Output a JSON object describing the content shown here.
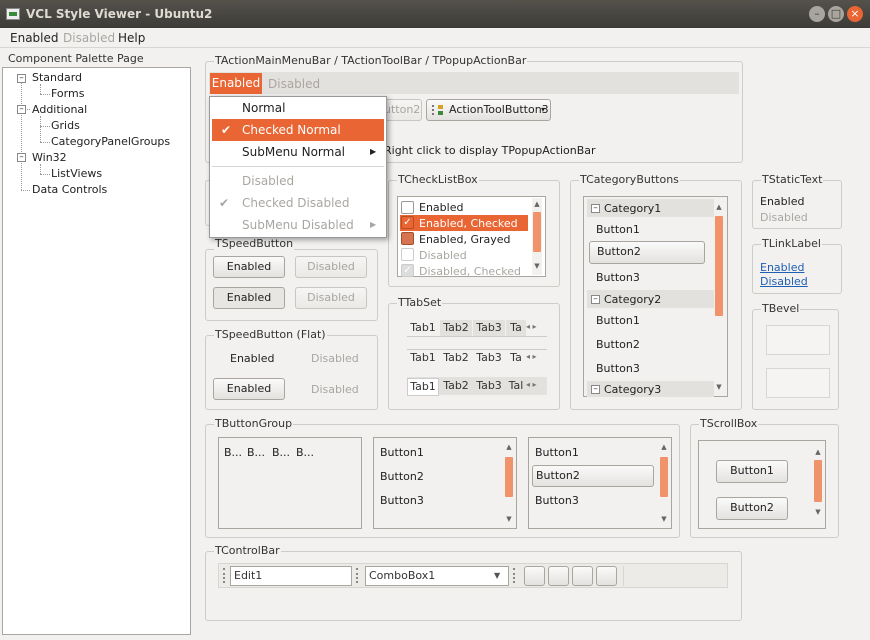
{
  "window": {
    "title": "VCL Style Viewer - Ubuntu2"
  },
  "menubar": [
    {
      "label": "Enabled",
      "enabled": true
    },
    {
      "label": "Disabled",
      "enabled": false
    },
    {
      "label": "Help",
      "enabled": true
    }
  ],
  "palette_label": "Component Palette Page",
  "tree": {
    "standard": "Standard",
    "forms": "Forms",
    "additional": "Additional",
    "grids": "Grids",
    "cpg": "CategoryPanelGroups",
    "win32": "Win32",
    "listviews": "ListViews",
    "datacontrols": "Data Controls"
  },
  "action_bar": {
    "group_label": "TActionMainMenuBar / TActionToolBar / TPopupActionBar",
    "menu_enabled": "Enabled",
    "menu_disabled": "Disabled",
    "tool_btn2": "utton2",
    "tool_btn3": "ActionToolButton3",
    "hint": "Right click to display TPopupActionBar"
  },
  "popup": {
    "normal": "Normal",
    "checked_normal": "Checked Normal",
    "submenu_normal": "SubMenu Normal",
    "disabled": "Disabled",
    "checked_disabled": "Checked Disabled",
    "submenu_disabled": "SubMenu Disabled"
  },
  "speed": {
    "label": "TSpeedButton",
    "enabled": "Enabled",
    "disabled": "Disabled",
    "flat_label": "TSpeedButton (Flat)"
  },
  "checklist": {
    "label": "TCheckListBox",
    "items": [
      "Enabled",
      "Enabled, Checked",
      "Enabled, Grayed",
      "Disabled",
      "Disabled, Checked"
    ]
  },
  "tabset": {
    "label": "TTabSet",
    "tabs": [
      "Tab1",
      "Tab2",
      "Tab3",
      "Ta"
    ],
    "tabs3": [
      "Tab1",
      "Tab2",
      "Tab3",
      "Tal"
    ]
  },
  "category": {
    "label": "TCategoryButtons",
    "cat1": "Category1",
    "cat2": "Category2",
    "cat3": "Category3",
    "buttons": [
      "Button1",
      "Button2",
      "Button3"
    ]
  },
  "static_text": {
    "label": "TStaticText",
    "enabled": "Enabled",
    "disabled": "Disabled"
  },
  "link_label": {
    "label": "TLinkLabel",
    "enabled": "Enabled",
    "disabled": "Disabled"
  },
  "bevel": {
    "label": "TBevel"
  },
  "button_group": {
    "label": "TButtonGroup",
    "small": [
      "B...",
      "B...",
      "B...",
      "B..."
    ],
    "buttons": [
      "Button1",
      "Button2",
      "Button3"
    ]
  },
  "scroll_box": {
    "label": "TScrollBox",
    "buttons": [
      "Button1",
      "Button2"
    ]
  },
  "control_bar": {
    "label": "TControlBar",
    "edit": "Edit1",
    "combo": "ComboBox1"
  },
  "colors": {
    "accent": "#e96533",
    "accent_light": "#f0926a",
    "link": "#1f5fb4"
  }
}
